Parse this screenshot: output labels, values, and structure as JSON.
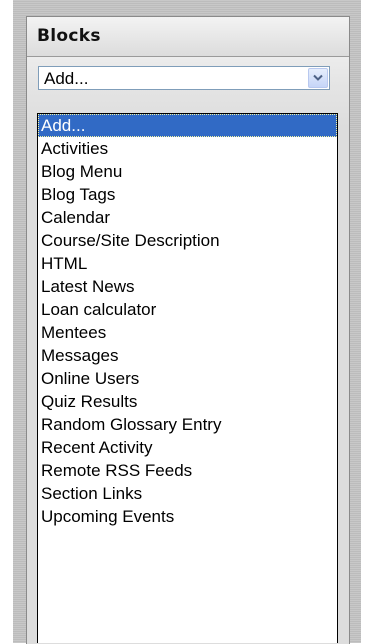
{
  "block": {
    "title": "Blocks"
  },
  "select": {
    "value": "Add...",
    "arrow_icon": "chevron-down-icon"
  },
  "dropdown": {
    "selected_index": 0,
    "options": [
      "Add...",
      "Activities",
      "Blog Menu",
      "Blog Tags",
      "Calendar",
      "Course/Site Description",
      "HTML",
      "Latest News",
      "Loan calculator",
      "Mentees",
      "Messages",
      "Online Users",
      "Quiz Results",
      "Random Glossary Entry",
      "Recent Activity",
      "Remote RSS Feeds",
      "Section Links",
      "Upcoming Events"
    ]
  },
  "colors": {
    "selection": "#316ac5",
    "arrow": "#4d6185"
  }
}
